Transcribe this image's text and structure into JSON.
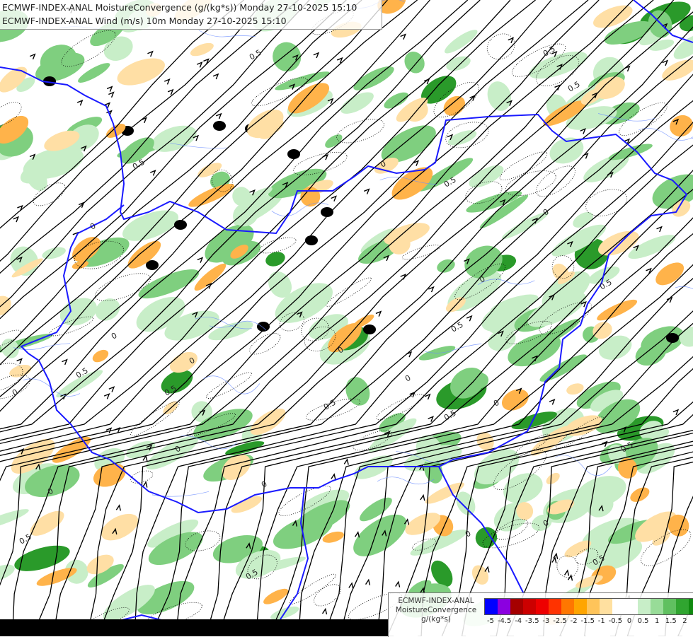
{
  "titles": {
    "line1": "ECMWF-INDEX-ANAL MoistureConvergence (g/(kg*s)) Monday 27-10-2025 15:10",
    "line2": "ECMWF-INDEX-ANAL Wind (m/s) 10m Monday 27-10-2025 15:10"
  },
  "legend": {
    "line1": "ECMWF-INDEX-ANAL",
    "line2": "MoistureConvergence",
    "line3": "g/(kg*s)",
    "colors": [
      "#0000ff",
      "#8b00e0",
      "#a50000",
      "#cc0000",
      "#ee0000",
      "#ff3300",
      "#ff7700",
      "#ffa500",
      "#ffc45a",
      "#ffe0a0",
      "#ffffff",
      "#ffffff",
      "#c8eec8",
      "#98dc98",
      "#60c060",
      "#30a530",
      "#108a10"
    ],
    "ticks": [
      "-5",
      "-4.5",
      "-4",
      "-3.5",
      "-3",
      "-2.5",
      "-2",
      "-1.5",
      "-1",
      "-0.5",
      "0",
      "0.5",
      "1",
      "1.5",
      "2"
    ]
  },
  "map": {
    "contour_labels": [
      "0.5",
      "0.5",
      "0.5",
      "0.5",
      "0.5",
      "0",
      "0",
      "0",
      "0",
      "0",
      "0.5",
      "0.5",
      "0",
      "0.5",
      "0.5",
      "0",
      "0.5",
      "0.5",
      "0",
      "0",
      "0",
      "0",
      "0.5",
      "0.5",
      "0",
      "0",
      "0.5",
      "0.5",
      "0",
      "0"
    ],
    "colors": {
      "border": "#1a1aff",
      "streamline": "#000000",
      "green_light": "#c8eec8",
      "green_mid": "#7fcf7f",
      "green_dark": "#2a9a2a",
      "orange_light": "#ffdfa5",
      "orange": "#ffb34a"
    }
  }
}
